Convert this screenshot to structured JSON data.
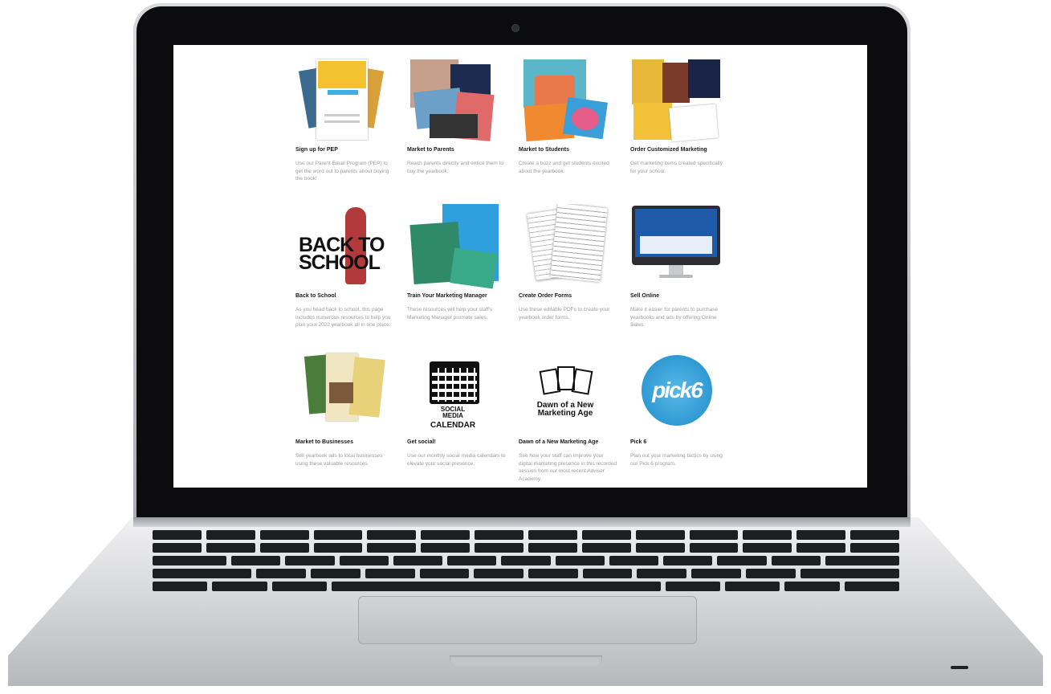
{
  "cards": [
    {
      "title": "Sign up for PEP",
      "desc": "Use our Parent Email Program (PEP) to get the word out to parents about buying the book!"
    },
    {
      "title": "Market to Parents",
      "desc": "Reach parents directly and entice them to buy the yearbook."
    },
    {
      "title": "Market to Students",
      "desc": "Create a buzz and get students excited about the yearbook."
    },
    {
      "title": "Order Customized Marketing",
      "desc": "Get marketing items created specifically for your school."
    },
    {
      "title": "Back to School",
      "desc": "As you head back to school, this page includes numerous resources to help you plan your 2022 yearbook all in one place."
    },
    {
      "title": "Train Your Marketing Manager",
      "desc": "These resources will help your staff's Marketing Manager promote sales."
    },
    {
      "title": "Create Order Forms",
      "desc": "Use these editable PDFs to create your yearbook order forms."
    },
    {
      "title": "Sell Online",
      "desc": "Make it easier for parents to purchase yearbooks and ads by offering Online Sales."
    },
    {
      "title": "Market to Businesses",
      "desc": "Sell yearbook ads to local businesses using these valuable resources."
    },
    {
      "title": "Get social!",
      "desc": "Use our monthly social media calendars to elevate your social presence."
    },
    {
      "title": "Dawn of a New Marketing Age",
      "desc": "See how your staff can improve your digital marketing presence in this recorded session from our most recent Adviser Academy."
    },
    {
      "title": "Pick 6",
      "desc": "Plan out your marketing tactics by using our Pick 6 program."
    }
  ],
  "thumb_text": {
    "back_to_school": [
      "BACK TO",
      "SCHOOL"
    ],
    "social_calendar": [
      "SOCIAL MEDIA",
      "CALENDAR"
    ],
    "dawn": [
      "Dawn of a New",
      "Marketing Age"
    ],
    "pick6": "pick6"
  },
  "colors": {
    "title": "#1b1b1b",
    "desc": "#9c9c9c",
    "pick6": "#2a9ad6"
  }
}
